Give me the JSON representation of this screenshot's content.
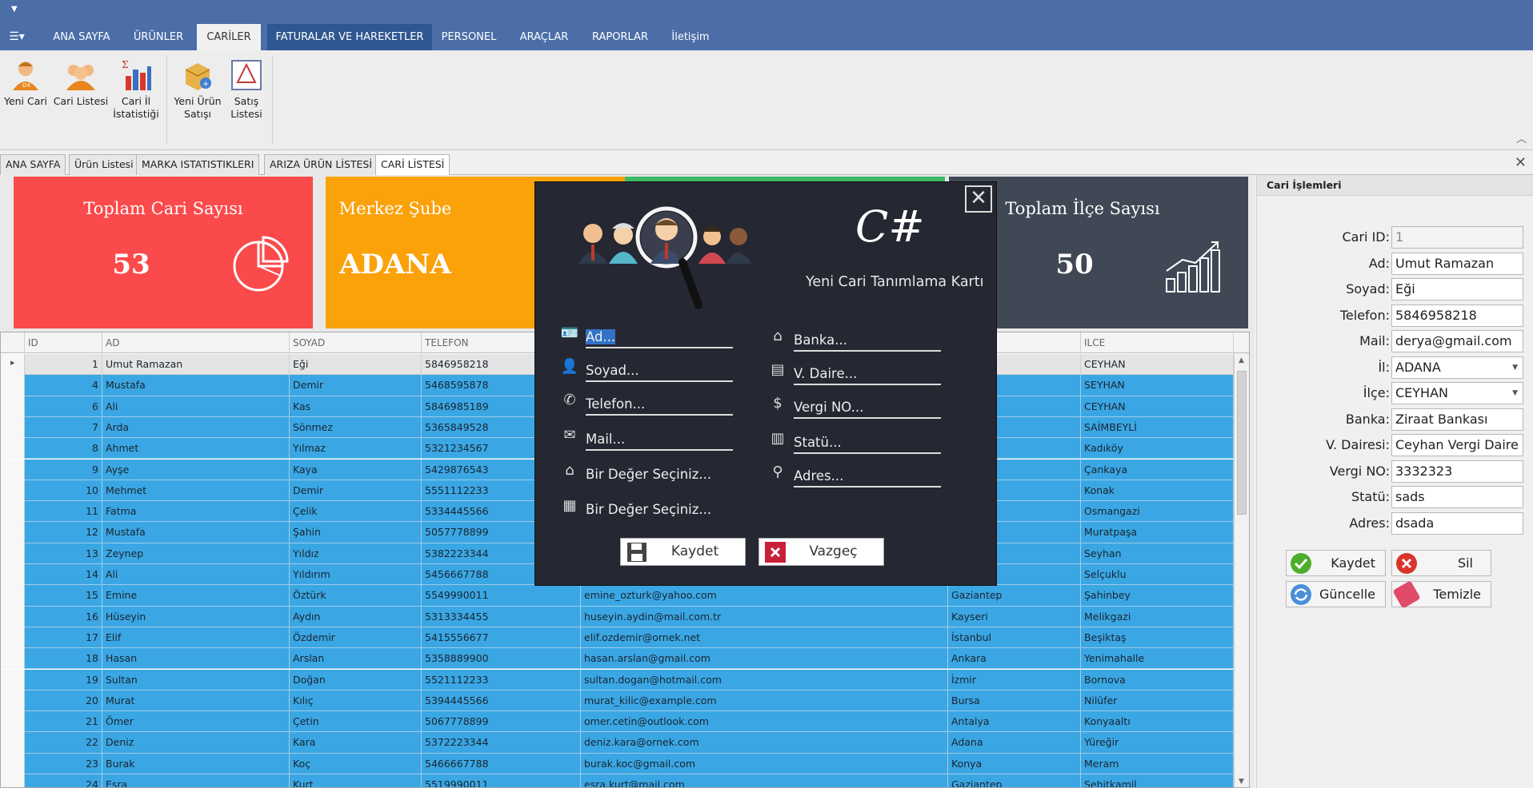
{
  "menu": {
    "tabs": [
      {
        "label": "ANA SAYFA"
      },
      {
        "label": "ÜRÜNLER"
      },
      {
        "label": "CARİLER"
      },
      {
        "label": "FATURALAR VE HAREKETLER"
      },
      {
        "label": "PERSONEL"
      },
      {
        "label": "ARAÇLAR"
      },
      {
        "label": "RAPORLAR"
      },
      {
        "label": "İletişim"
      }
    ],
    "active": "CARİLER"
  },
  "ribbon": {
    "buttons": [
      {
        "label": "Yeni Cari",
        "icon": "new-customer-icon"
      },
      {
        "label": "Cari Listesi",
        "icon": "customer-list-icon"
      },
      {
        "label": "Cari İl İstatistiği",
        "icon": "city-statistics-icon"
      },
      {
        "label": "Yeni Ürün Satışı",
        "icon": "new-sale-icon"
      },
      {
        "label": "Satış Listesi",
        "icon": "sales-list-icon"
      }
    ]
  },
  "doc_tabs": [
    "ANA SAYFA",
    "Ürün Listesi",
    "MARKA ISTATISTIKLERI",
    "ARIZA ÜRÜN LİSTESİ",
    "CARİ LİSTESİ"
  ],
  "tiles": [
    {
      "title": "Toplam Cari Sayısı",
      "value": "53",
      "color": "#fb4a4b"
    },
    {
      "title": "Merkez Şube",
      "value": "ADANA",
      "color": "#fba10a"
    },
    {
      "title": "Toplam İlçe Sayısı",
      "value": "50",
      "color": "#404855"
    }
  ],
  "grid": {
    "columns": [
      "ID",
      "AD",
      "SOYAD",
      "TELEFON",
      "",
      "",
      "ILCE"
    ],
    "rows": [
      {
        "id": "1",
        "ad": "Umut Ramazan",
        "soyad": "Eği",
        "tel": "5846958218",
        "mail": "",
        "il": "",
        "ilce": "CEYHAN"
      },
      {
        "id": "4",
        "ad": "Mustafa",
        "soyad": "Demir",
        "tel": "5468595878",
        "mail": "",
        "il": "",
        "ilce": "SEYHAN"
      },
      {
        "id": "6",
        "ad": "Ali",
        "soyad": "Kas",
        "tel": "5846985189",
        "mail": "",
        "il": "",
        "ilce": "CEYHAN"
      },
      {
        "id": "7",
        "ad": "Arda",
        "soyad": "Sönmez",
        "tel": "5365849528",
        "mail": "",
        "il": "",
        "ilce": "SAİMBEYLİ"
      },
      {
        "id": "8",
        "ad": "Ahmet",
        "soyad": "Yılmaz",
        "tel": "5321234567",
        "mail": "",
        "il": "",
        "ilce": "Kadıköy"
      },
      {
        "id": "9",
        "ad": "Ayşe",
        "soyad": "Kaya",
        "tel": "5429876543",
        "mail": "",
        "il": "",
        "ilce": "Çankaya"
      },
      {
        "id": "10",
        "ad": "Mehmet",
        "soyad": "Demir",
        "tel": "5551112233",
        "mail": "",
        "il": "",
        "ilce": "Konak"
      },
      {
        "id": "11",
        "ad": "Fatma",
        "soyad": "Çelik",
        "tel": "5334445566",
        "mail": "",
        "il": "",
        "ilce": "Osmangazi"
      },
      {
        "id": "12",
        "ad": "Mustafa",
        "soyad": "Şahin",
        "tel": "5057778899",
        "mail": "",
        "il": "",
        "ilce": "Muratpaşa"
      },
      {
        "id": "13",
        "ad": "Zeynep",
        "soyad": "Yıldız",
        "tel": "5382223344",
        "mail": "",
        "il": "",
        "ilce": "Seyhan"
      },
      {
        "id": "14",
        "ad": "Ali",
        "soyad": "Yıldırım",
        "tel": "5456667788",
        "mail": "",
        "il": "",
        "ilce": "Selçuklu"
      },
      {
        "id": "15",
        "ad": "Emine",
        "soyad": "Öztürk",
        "tel": "5549990011",
        "mail": "emine_ozturk@yahoo.com",
        "il": "Gaziantep",
        "ilce": "Şahinbey"
      },
      {
        "id": "16",
        "ad": "Hüseyin",
        "soyad": "Aydın",
        "tel": "5313334455",
        "mail": "huseyin.aydin@mail.com.tr",
        "il": "Kayseri",
        "ilce": "Melikgazi"
      },
      {
        "id": "17",
        "ad": "Elif",
        "soyad": "Özdemir",
        "tel": "5415556677",
        "mail": "elif.ozdemir@ornek.net",
        "il": "İstanbul",
        "ilce": "Beşiktaş"
      },
      {
        "id": "18",
        "ad": "Hasan",
        "soyad": "Arslan",
        "tel": "5358889900",
        "mail": "hasan.arslan@gmail.com",
        "il": "Ankara",
        "ilce": "Yenimahalle"
      },
      {
        "id": "19",
        "ad": "Sultan",
        "soyad": "Doğan",
        "tel": "5521112233",
        "mail": "sultan.dogan@hotmail.com",
        "il": "İzmir",
        "ilce": "Bornova"
      },
      {
        "id": "20",
        "ad": "Murat",
        "soyad": "Kılıç",
        "tel": "5394445566",
        "mail": "murat_kilic@example.com",
        "il": "Bursa",
        "ilce": "Nilüfer"
      },
      {
        "id": "21",
        "ad": "Ömer",
        "soyad": "Çetin",
        "tel": "5067778899",
        "mail": "omer.cetin@outlook.com",
        "il": "Antalya",
        "ilce": "Konyaaltı"
      },
      {
        "id": "22",
        "ad": "Deniz",
        "soyad": "Kara",
        "tel": "5372223344",
        "mail": "deniz.kara@ornek.com",
        "il": "Adana",
        "ilce": "Yüreğir"
      },
      {
        "id": "23",
        "ad": "Burak",
        "soyad": "Koç",
        "tel": "5466667788",
        "mail": "burak.koc@gmail.com",
        "il": "Konya",
        "ilce": "Meram"
      },
      {
        "id": "24",
        "ad": "Esra",
        "soyad": "Kurt",
        "tel": "5519990011",
        "mail": "esra.kurt@mail.com",
        "il": "Gaziantep",
        "ilce": "Şehitkamil"
      }
    ]
  },
  "side": {
    "title": "Cari İşlemleri",
    "fields": [
      {
        "label": "Cari ID:",
        "value": "1",
        "disabled": true
      },
      {
        "label": "Ad:",
        "value": "Umut Ramazan"
      },
      {
        "label": "Soyad:",
        "value": "Eği"
      },
      {
        "label": "Telefon:",
        "value": "5846958218"
      },
      {
        "label": "Mail:",
        "value": "derya@gmail.com"
      },
      {
        "label": "İl:",
        "value": "ADANA",
        "dropdown": true
      },
      {
        "label": "İlçe:",
        "value": "CEYHAN",
        "dropdown": true
      },
      {
        "label": "Banka:",
        "value": "Ziraat Bankası"
      },
      {
        "label": "V. Dairesi:",
        "value": "Ceyhan Vergi Daire"
      },
      {
        "label": "Vergi NO:",
        "value": "3332323"
      },
      {
        "label": "Statü:",
        "value": "sads"
      },
      {
        "label": "Adres:",
        "value": "dsada"
      }
    ],
    "buttons": [
      {
        "label": "Kaydet",
        "icon": "check-icon",
        "color": "#4cae2c"
      },
      {
        "label": "Sil",
        "icon": "delete-icon",
        "color": "#d9342b"
      },
      {
        "label": "Güncelle",
        "icon": "refresh-icon",
        "color": "#4a8fd8"
      },
      {
        "label": "Temizle",
        "icon": "eraser-icon",
        "color": "#e04b6a"
      }
    ]
  },
  "modal": {
    "logo": "C#",
    "subtitle": "Yeni Cari Tanımlama Kartı",
    "left_fields": [
      {
        "text": "Ad...",
        "icon": "id-card-icon",
        "selected": true
      },
      {
        "text": "Soyad...",
        "icon": "person-icon"
      },
      {
        "text": "Telefon...",
        "icon": "phone-icon"
      },
      {
        "text": "Mail...",
        "icon": "mail-icon"
      },
      {
        "text": "Bir Değer Seçiniz...",
        "icon": "city-icon",
        "dropdown": true
      },
      {
        "text": "Bir Değer Seçiniz...",
        "icon": "building-icon",
        "dropdown": true
      }
    ],
    "right_fields": [
      {
        "text": "Banka...",
        "icon": "bank-icon"
      },
      {
        "text": "V. Daire...",
        "icon": "tax-office-icon"
      },
      {
        "text": "Vergi NO...",
        "icon": "money-bag-icon"
      },
      {
        "text": "Statü...",
        "icon": "status-building-icon"
      },
      {
        "text": "Adres...",
        "icon": "location-pin-icon"
      }
    ],
    "save_label": "Kaydet",
    "cancel_label": "Vazgeç"
  }
}
